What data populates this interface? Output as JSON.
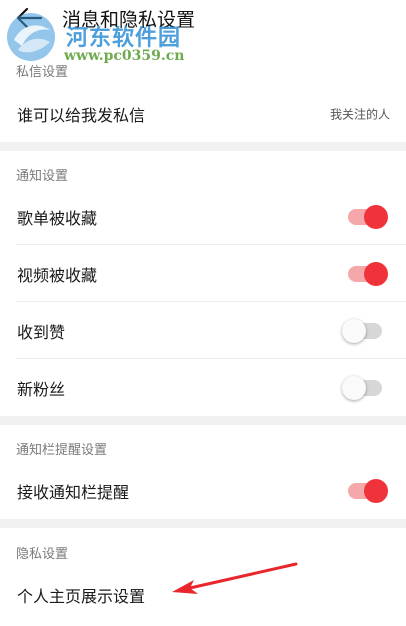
{
  "header": {
    "title": "消息和隐私设置",
    "back_icon": "back-arrow-icon"
  },
  "watermark": {
    "name": "河东软件园",
    "url": "www.pc0359.cn"
  },
  "sections": {
    "private_message": {
      "label": "私信设置",
      "who_can_message": {
        "label": "谁可以给我发私信",
        "value": "我关注的人"
      }
    },
    "notification": {
      "label": "通知设置",
      "playlist_favorited": {
        "label": "歌单被收藏",
        "on": true
      },
      "video_favorited": {
        "label": "视频被收藏",
        "on": true
      },
      "liked": {
        "label": "收到赞",
        "on": false
      },
      "new_follower": {
        "label": "新粉丝",
        "on": false
      }
    },
    "notification_bar": {
      "label": "通知栏提醒设置",
      "receive_reminder": {
        "label": "接收通知栏提醒",
        "on": true
      }
    },
    "privacy": {
      "label": "隐私设置",
      "profile_display": {
        "label": "个人主页展示设置"
      }
    }
  },
  "colors": {
    "accent": "#f0323a",
    "toggle_track_on": "#f5a8a9",
    "toggle_track_off": "#d7d7d7",
    "section_gap": "#f1f1f1",
    "annotation_arrow": "#e8262c"
  }
}
